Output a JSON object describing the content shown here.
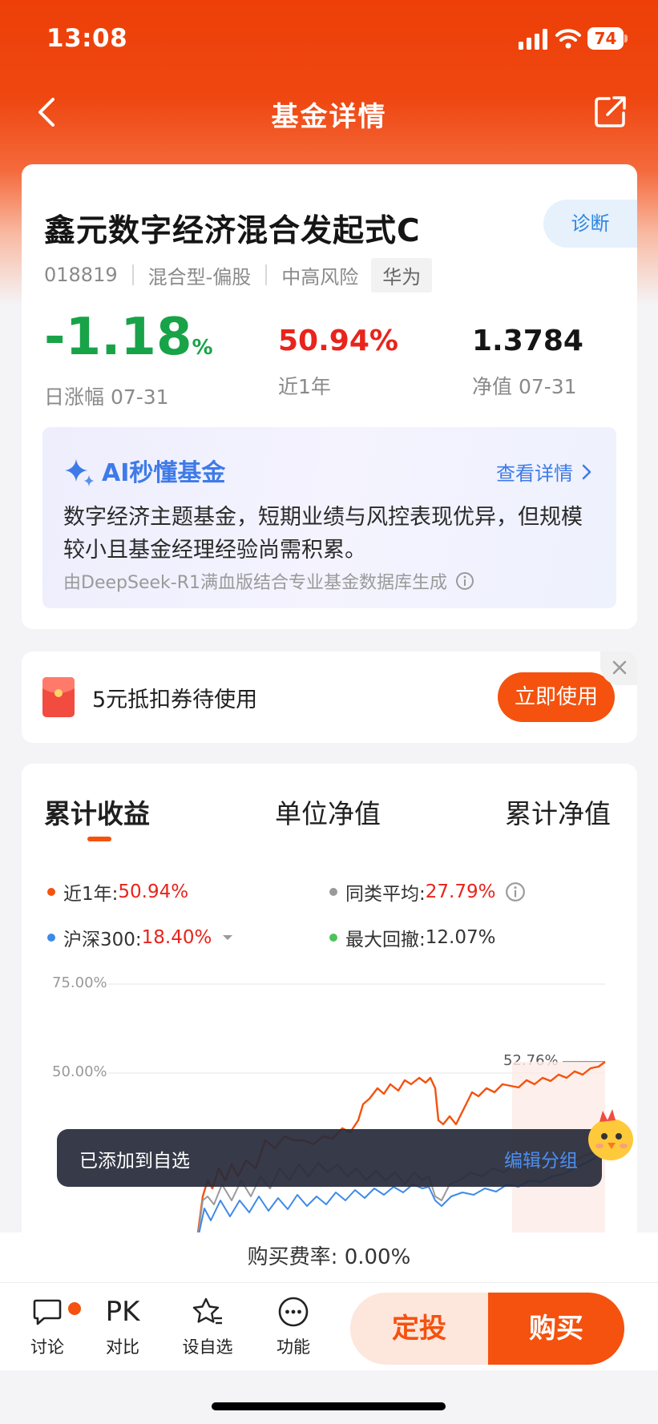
{
  "status_bar": {
    "time": "13:08",
    "battery": "74"
  },
  "nav": {
    "title": "基金详情"
  },
  "fund": {
    "name": "鑫元数字经济混合发起式C",
    "diagnose_label": "诊断",
    "code": "018819",
    "type": "混合型-偏股",
    "risk": "中高风险",
    "tag": "华为",
    "daily_change_value": "-1.18",
    "daily_change_unit": "%",
    "daily_change_label": "日涨幅 07-31",
    "one_year_value": "50.94%",
    "one_year_label": "近1年",
    "nav_value": "1.3784",
    "nav_label": "净值 07-31"
  },
  "ai_summary": {
    "title": "AI秒懂基金",
    "more_label": "查看详情",
    "description": "数字经济主题基金，短期业绩与风控表现优异，但规模较小且基金经理经验尚需积累。",
    "source": "由DeepSeek-R1满血版结合专业基金数据库生成"
  },
  "coupon": {
    "text": "5元抵扣券待使用",
    "button": "立即使用"
  },
  "chart": {
    "tabs": [
      "累计收益",
      "单位净值",
      "累计净值"
    ],
    "legend": {
      "fund_label": "近1年:",
      "fund_value": "50.94%",
      "peer_label": "同类平均:",
      "peer_value": "27.79%",
      "index_label": "沪深300:",
      "index_value": "18.40%",
      "drawdown_label": "最大回撤:",
      "drawdown_value": "12.07%"
    },
    "y_ticks": [
      "75.00%",
      "50.00%"
    ],
    "end_label": "52.76%",
    "colors": {
      "fund": "#f4520e",
      "peer": "#9a9a9a",
      "index": "#3e8ae8",
      "drawdown": "#4cc35a"
    }
  },
  "chart_data": {
    "type": "line",
    "ylabel": "",
    "ylim_visible": [
      75,
      50
    ],
    "series": [
      {
        "name": "近1年",
        "last_value": 52.76
      },
      {
        "name": "同类平均",
        "last_value": 27.79
      },
      {
        "name": "沪深300",
        "last_value": 18.4
      }
    ]
  },
  "toast": {
    "text": "已添加到自选",
    "action": "编辑分组"
  },
  "fee": {
    "label": "购买费率:",
    "value": "0.00%"
  },
  "bottom_bar": {
    "discuss": "讨论",
    "compare_icon": "PK",
    "compare": "对比",
    "watchlist": "设自选",
    "functions": "功能",
    "sip_button": "定投",
    "buy_button": "购买"
  }
}
